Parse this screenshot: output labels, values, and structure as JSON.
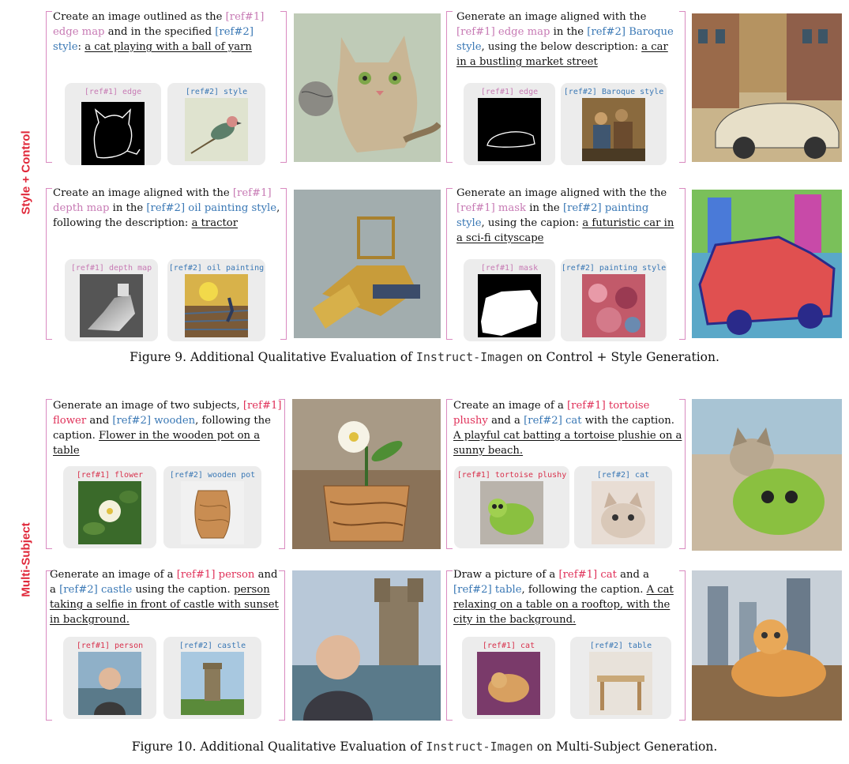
{
  "side_labels": {
    "top": "Style + Control",
    "bottom": "Multi-Subject"
  },
  "fig9": {
    "p1": {
      "a": "Create an image outlined as the",
      "r1": "[ref#1] edge map",
      "b": " and in the specified",
      "r2": "[ref#2] style",
      "c": ": ",
      "u": "a cat playing with a ball of yarn",
      "ref1_cap": "[ref#1] edge",
      "ref2_cap": "[ref#2] style"
    },
    "p2": {
      "a": "Generate an image aligned with the",
      "r1": "[ref#1] edge map",
      "b": " in the ",
      "r2": "[ref#2] Baroque style",
      "c": ", using the below description: ",
      "u": "a car in a bustling market street",
      "ref1_cap": "[ref#1] edge",
      "ref2_cap": "[ref#2] Baroque style"
    },
    "p3": {
      "a": "Create an image aligned with the",
      "r1": "[ref#1] depth map",
      "b": " in the ",
      "r2": "[ref#2] oil painting style",
      "c": ", following the description: ",
      "u": "a tractor",
      "ref1_cap": "[ref#1] depth map",
      "ref2_cap": "[ref#2] oil painting"
    },
    "p4": {
      "a": "Generate an image aligned with the",
      "r1": "[ref#1] mask",
      "b": " in the ",
      "r2": "[ref#2] painting style",
      "c": ", using the  capion: ",
      "u": "a futuristic car in a sci-fi cityscape",
      "ref1_cap": "[ref#1] mask",
      "ref2_cap": "[ref#2] painting style"
    },
    "caption_a": "Figure 9. Additional Qualitative Evaluation of ",
    "caption_mono": "Instruct-Imagen",
    "caption_b": " on Control + Style Generation."
  },
  "fig10": {
    "p1": {
      "a": "Generate an image of two subjects,",
      "r1": "[ref#1] flower",
      "b": " and ",
      "r2": "[ref#2] wooden",
      "c": ", following the caption. ",
      "u": "Flower in the wooden pot on a table",
      "ref1_cap": "[ref#1] flower",
      "ref2_cap": "[ref#2] wooden pot"
    },
    "p2": {
      "a": "Create an image of a ",
      "r1": "[ref#1] tortoise plushy",
      "b": " and a ",
      "r2": "[ref#2] cat",
      "c": " with the caption. ",
      "u": "A playful cat batting a tortoise plushie on a sunny beach.",
      "ref1_cap": "[ref#1] tortoise plushy",
      "ref2_cap": "[ref#2] cat"
    },
    "p3": {
      "a": "Generate an image of a ",
      "r1": "[ref#1] person",
      "b": " and a ",
      "r2": "[ref#2] castle",
      "c": " using the caption. ",
      "u": "person taking a selfie in front of castle with sunset in background.",
      "ref1_cap": "[ref#1] person",
      "ref2_cap": "[ref#2] castle"
    },
    "p4": {
      "a": "Draw a picture of a ",
      "r1": "[ref#1] cat",
      "b": " and a ",
      "r2": "[ref#2] table",
      "c": ", following the caption. ",
      "u": "A cat relaxing on a table on a rooftop, with the city in the background.",
      "ref1_cap": "[ref#1] cat",
      "ref2_cap": "[ref#2] table"
    },
    "caption_a": "Figure 10. Additional Qualitative Evaluation of ",
    "caption_mono": "Instruct-Imagen",
    "caption_b": " on Multi-Subject Generation."
  }
}
